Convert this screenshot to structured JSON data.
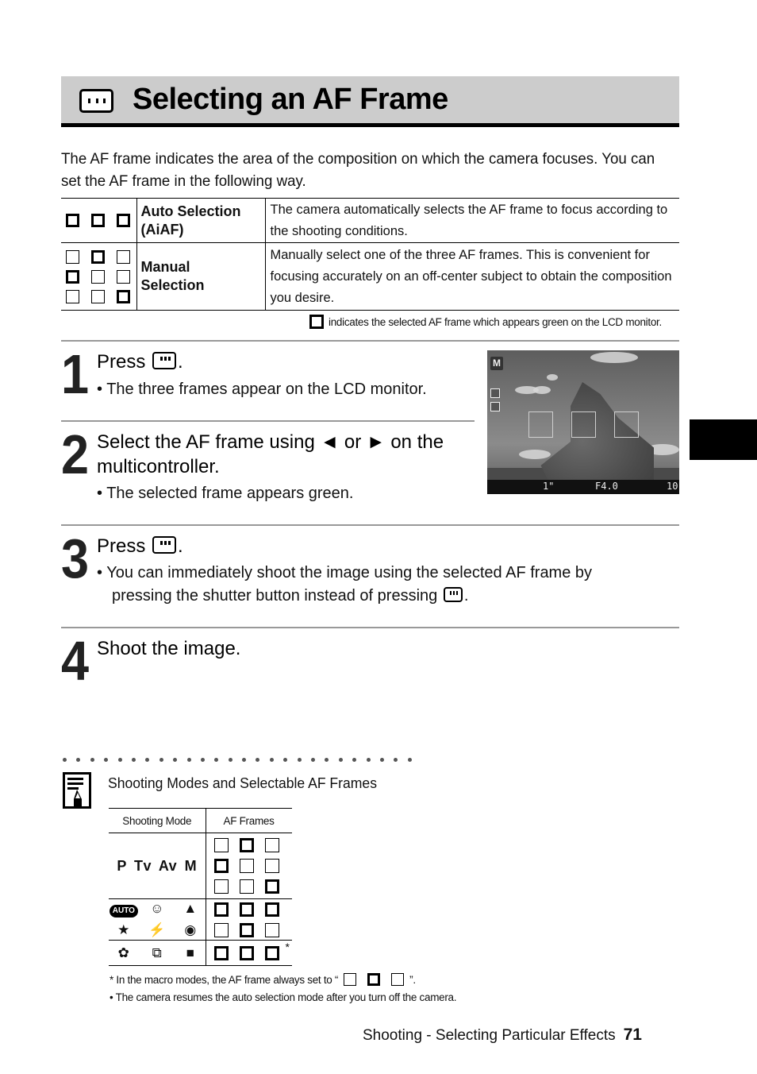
{
  "title": {
    "icon": "af-frame-button-icon",
    "text": "Selecting an AF Frame"
  },
  "intro": "The AF frame indicates the area of the composition on which the camera focuses. You can set the AF frame in the following way.",
  "modes_table": {
    "rows": [
      {
        "frames": [
          [
            1,
            1,
            1
          ]
        ],
        "name_line1": "Auto Selection",
        "name_line2": "(AiAF)",
        "description": "The camera automatically selects the AF frame to focus according to the shooting conditions."
      },
      {
        "frames": [
          [
            0,
            1,
            0
          ],
          [
            1,
            0,
            0
          ],
          [
            0,
            0,
            1
          ]
        ],
        "name_line1": "Manual",
        "name_line2": "Selection",
        "description": "Manually select one of the three AF frames. This is convenient for focusing accurately on an off-center subject to obtain the composition you desire."
      }
    ],
    "legend": "indicates the selected AF frame which appears green on the LCD monitor."
  },
  "steps": [
    {
      "number": "1",
      "title_prefix": "Press",
      "title_suffix": ".",
      "bullet": "• The three frames appear on the LCD monitor."
    },
    {
      "number": "2",
      "title_line1": "Select the AF frame using ◄ or ► on the",
      "title_line2": "multicontroller.",
      "bullet": "• The selected frame appears green."
    },
    {
      "number": "3",
      "title_prefix": "Press",
      "title_suffix": ".",
      "bullet_line1": "• You can immediately shoot the image using the selected AF frame by",
      "bullet_line2_prefix": "pressing the shutter button instead of pressing",
      "bullet_line2_suffix": "."
    },
    {
      "number": "4",
      "title": "Shoot the image."
    }
  ],
  "lcd": {
    "mode": "M",
    "shutter": "1\"",
    "aperture": "F4.0",
    "shots_remaining": "10"
  },
  "memo": {
    "icon": "memo-pencil-icon",
    "title": "Shooting Modes and Selectable AF Frames",
    "table": {
      "headers": [
        "Shooting Mode",
        "AF Frames"
      ],
      "rows": [
        {
          "modes": "P  Tv  Av  M",
          "frames": [
            [
              0,
              1,
              0
            ],
            [
              1,
              0,
              0
            ],
            [
              0,
              0,
              1
            ]
          ]
        },
        {
          "mode_icons": [
            "AUTO",
            "portrait",
            "landscape",
            "night-scene",
            "sports",
            "fast-shutter"
          ],
          "frames": [
            [
              1,
              1,
              1
            ],
            [
              0,
              1,
              0
            ]
          ]
        },
        {
          "mode_icons": [
            "macro",
            "stitch-assist",
            "movie"
          ],
          "frames": [
            [
              1,
              1,
              1
            ]
          ],
          "asterisk": "*"
        }
      ]
    },
    "footnote1_prefix": "* In the macro modes, the AF frame always set to “",
    "footnote1_suffix": "”.",
    "footnote2": "• The camera resumes the auto selection mode after you turn off the camera."
  },
  "footer": {
    "section": "Shooting - Selecting Particular Effects",
    "page": "71"
  }
}
